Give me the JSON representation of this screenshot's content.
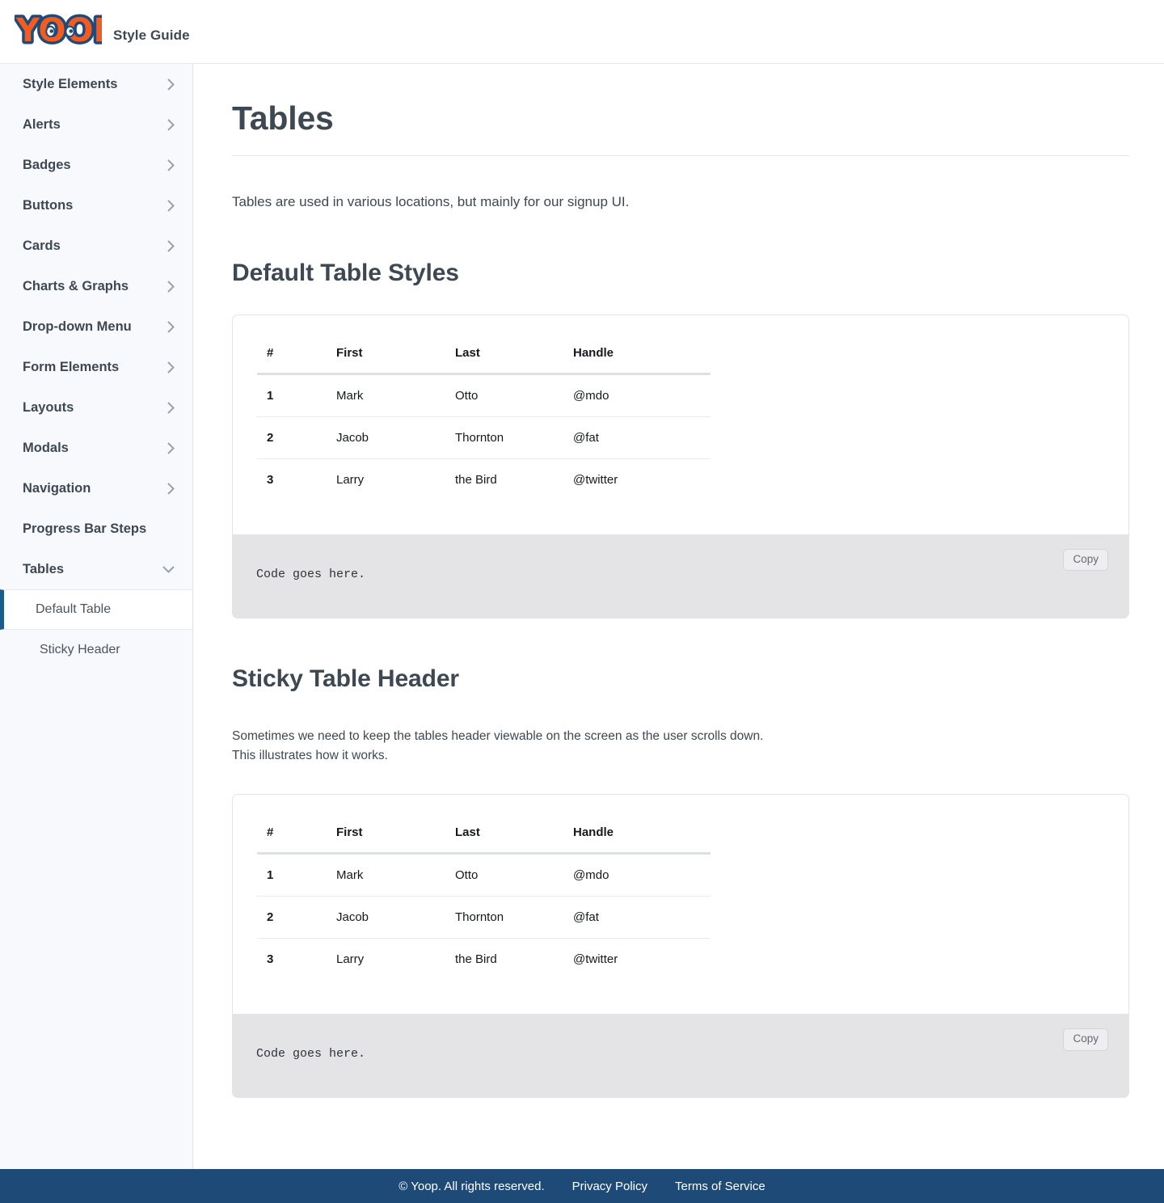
{
  "header": {
    "logo_text": "YOOP",
    "logo_color": "#f25c1e",
    "logo_outline_color": "#1f4a7a",
    "subtitle": "Style Guide"
  },
  "sidebar": {
    "items": [
      {
        "label": "Style Elements",
        "icon": "chevron-right-icon",
        "expanded": false
      },
      {
        "label": "Alerts",
        "icon": "chevron-right-icon",
        "expanded": false
      },
      {
        "label": "Badges",
        "icon": "chevron-right-icon",
        "expanded": false
      },
      {
        "label": "Buttons",
        "icon": "chevron-right-icon",
        "expanded": false
      },
      {
        "label": "Cards",
        "icon": "chevron-right-icon",
        "expanded": false
      },
      {
        "label": "Charts & Graphs",
        "icon": "chevron-right-icon",
        "expanded": false
      },
      {
        "label": "Drop-down Menu",
        "icon": "chevron-right-icon",
        "expanded": false
      },
      {
        "label": "Form Elements",
        "icon": "chevron-right-icon",
        "expanded": false
      },
      {
        "label": "Layouts",
        "icon": "chevron-right-icon",
        "expanded": false
      },
      {
        "label": "Modals",
        "icon": "chevron-right-icon",
        "expanded": false
      },
      {
        "label": "Navigation",
        "icon": "chevron-right-icon",
        "expanded": false
      },
      {
        "label": "Progress Bar Steps",
        "icon": "",
        "expanded": false
      },
      {
        "label": "Tables",
        "icon": "chevron-down-icon",
        "expanded": true
      }
    ],
    "subitems": [
      {
        "label": "Default Table",
        "active": true
      },
      {
        "label": "Sticky Header",
        "active": false
      }
    ],
    "active_accent_color": "#1a5c91",
    "background_color": "#f8f9fc"
  },
  "main": {
    "page_title": "Tables",
    "lead": "Tables are used in various locations, but mainly for our signup UI.",
    "sections": [
      {
        "title": "Default Table Styles",
        "description": "",
        "code": "Code goes here.",
        "copy_label": "Copy"
      },
      {
        "title": "Sticky Table Header",
        "description": "Sometimes we need to keep the tables header viewable on the screen as the user scrolls down. This illustrates how it works.",
        "code": "Code goes here.",
        "copy_label": "Copy"
      }
    ]
  },
  "table": {
    "columns": [
      "#",
      "First",
      "Last",
      "Handle"
    ],
    "rows": [
      [
        "1",
        "Mark",
        "Otto",
        "@mdo"
      ],
      [
        "2",
        "Jacob",
        "Thornton",
        "@fat"
      ],
      [
        "3",
        "Larry",
        "the Bird",
        "@twitter"
      ]
    ]
  },
  "footer": {
    "copyright": "© Yoop. All rights reserved.",
    "links": [
      "Privacy Policy",
      "Terms of Service"
    ],
    "background_color": "#1e4a78"
  }
}
